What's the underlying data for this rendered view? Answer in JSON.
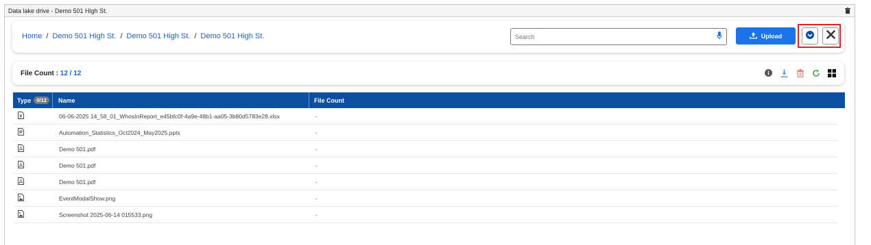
{
  "window": {
    "title": "Data lake drive - Demo 501 High St."
  },
  "breadcrumb": {
    "items": [
      "Home",
      "Demo 501 High St.",
      "Demo 501 High St.",
      "Demo 501 High St."
    ],
    "separator": "/"
  },
  "search": {
    "placeholder": "Search",
    "value": ""
  },
  "toolbar": {
    "upload_label": "Upload"
  },
  "file_count": {
    "label": "File Count :",
    "value": "12 / 12"
  },
  "table": {
    "headers": {
      "type": "Type",
      "type_badge": "0/12",
      "name": "Name",
      "file_count": "File Count"
    },
    "rows": [
      {
        "icon": "excel-file-icon",
        "name": "06-06-2025 14_58_01_WhosInReport_e45bfc0f-4a9e-48b1-aa05-3b80d5783e28.xlsx",
        "count": "-"
      },
      {
        "icon": "powerpoint-file-icon",
        "name": "Automation_Statistics_Oct2024_May2025.pptx",
        "count": "-"
      },
      {
        "icon": "pdf-file-icon",
        "name": "Demo 501.pdf",
        "count": "-"
      },
      {
        "icon": "pdf-file-icon",
        "name": "Demo 501.pdf",
        "count": "-"
      },
      {
        "icon": "pdf-file-icon",
        "name": "Demo 501.pdf",
        "count": "-"
      },
      {
        "icon": "image-file-icon",
        "name": "EventModalShow.png",
        "count": "-"
      },
      {
        "icon": "image-file-icon",
        "name": "Screenshot 2025-06-14 015533.png",
        "count": "-"
      }
    ]
  },
  "colors": {
    "accent": "#1a73e8",
    "header_bg": "#0c4ea0",
    "link": "#1a63c8",
    "highlight": "#d9232d",
    "delete": "#e57373",
    "refresh": "#43a047"
  }
}
